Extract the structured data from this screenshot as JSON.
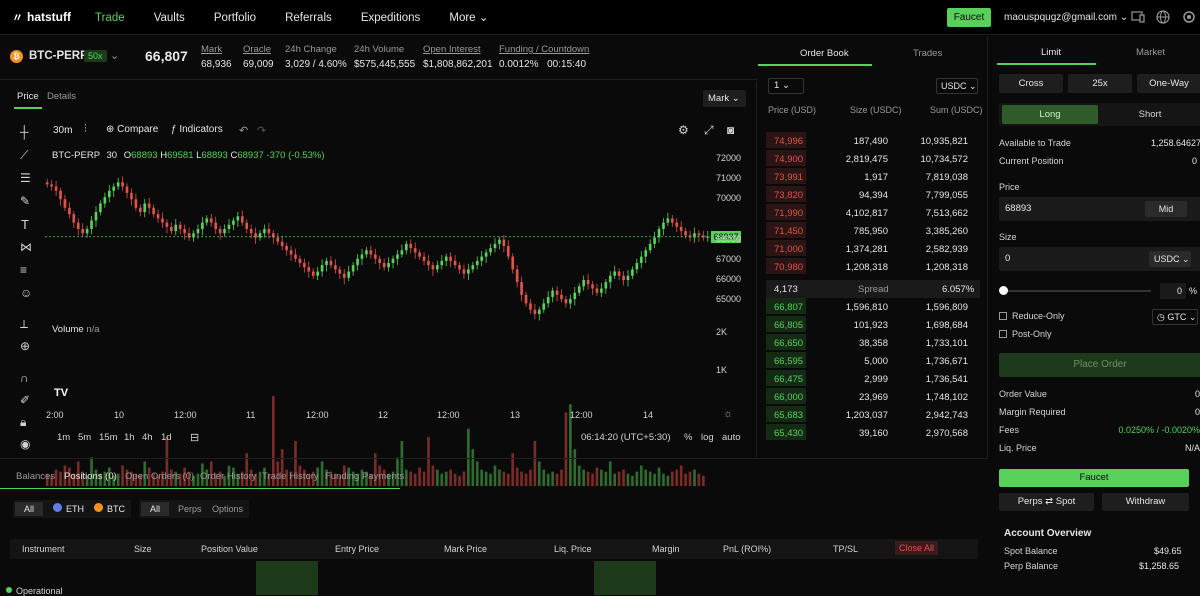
{
  "nav": {
    "brand": "hatstuff",
    "items": [
      "Trade",
      "Vaults",
      "Portfolio",
      "Referrals",
      "Expeditions",
      "More"
    ],
    "faucet": "Faucet",
    "email": "maouspqugz@gmail.com"
  },
  "market": {
    "symbol": "BTC-PERP",
    "leverage": "50x",
    "price": "66,807",
    "stats": [
      {
        "label": "Mark",
        "value": "68,936"
      },
      {
        "label": "Oracle",
        "value": "69,009"
      },
      {
        "label": "24h Change",
        "value": "3,029 / 4.60%"
      },
      {
        "label": "24h Volume",
        "value": "$575,445,555"
      },
      {
        "label": "Open Interest",
        "value": "$1,808,862,201"
      },
      {
        "label": "Funding / Countdown",
        "value": "0.0012%",
        "value2": "00:15:40"
      }
    ]
  },
  "chart": {
    "tabs": [
      "Price",
      "Details"
    ],
    "mark_select": "Mark",
    "interval": "30m",
    "compare": "Compare",
    "indicators": "Indicators",
    "legend_symbol": "BTC-PERP",
    "legend_interval": "30",
    "legend_o": "68893",
    "legend_h": "69581",
    "legend_l": "68893",
    "legend_c": "68937",
    "legend_chg": "-370 (-0.53%)",
    "current_price_label": "68937",
    "volume_label": "Volume",
    "volume_na": "n/a",
    "y_ticks": [
      "72000",
      "71000",
      "70000",
      "69000",
      "68000",
      "67000",
      "66000",
      "65000"
    ],
    "vol_ticks": [
      "2K",
      "1K"
    ],
    "x_ticks": [
      "2:00",
      "10",
      "12:00",
      "11",
      "12:00",
      "12",
      "12:00",
      "13",
      "12:00",
      "14"
    ],
    "timeframes": [
      "1m",
      "5m",
      "15m",
      "1h",
      "4h",
      "1d"
    ],
    "time": "06:14:20 (UTC+5:30)",
    "scale_opts": [
      "%",
      "log",
      "auto"
    ]
  },
  "chart_data": {
    "type": "candlestick",
    "symbol": "BTC-PERP",
    "interval": "30m",
    "ylim": [
      64500,
      72500
    ],
    "closes": [
      71400,
      71300,
      71100,
      70700,
      70300,
      70000,
      69600,
      69300,
      69100,
      69300,
      69700,
      70100,
      70500,
      70800,
      71100,
      71300,
      71500,
      71300,
      71000,
      70700,
      70300,
      70100,
      70500,
      70300,
      70000,
      69800,
      69600,
      69400,
      69200,
      69500,
      69300,
      69100,
      68900,
      69100,
      69300,
      69600,
      69800,
      69600,
      69300,
      69100,
      69300,
      69500,
      69700,
      69900,
      69600,
      69300,
      69100,
      68900,
      69100,
      69300,
      69100,
      68900,
      68700,
      68500,
      68300,
      68100,
      67900,
      67700,
      67500,
      67300,
      67100,
      67300,
      67600,
      67800,
      67600,
      67400,
      67200,
      67000,
      67300,
      67600,
      67900,
      68100,
      68300,
      68100,
      67900,
      67700,
      67500,
      67700,
      67900,
      68100,
      68300,
      68600,
      68400,
      68200,
      68000,
      67800,
      67600,
      67400,
      67600,
      67800,
      68000,
      67800,
      67600,
      67400,
      67200,
      67400,
      67600,
      67800,
      68000,
      68200,
      68400,
      68600,
      68800,
      68500,
      68000,
      67400,
      66800,
      66200,
      65800,
      65500,
      65300,
      65500,
      65800,
      66100,
      66400,
      66200,
      66000,
      65800,
      66000,
      66300,
      66600,
      66900,
      66700,
      66500,
      66300,
      66500,
      66800,
      67100,
      67300,
      67100,
      66900,
      67100,
      67400,
      67700,
      68000,
      68300,
      68600,
      68900,
      69300,
      69600,
      69800,
      69600,
      69400,
      69200,
      69000,
      68900,
      69100,
      69000,
      68900,
      68937
    ],
    "volumes": [
      300,
      250,
      400,
      350,
      500,
      450,
      300,
      600,
      350,
      250,
      700,
      400,
      300,
      350,
      450,
      250,
      300,
      500,
      400,
      350,
      300,
      280,
      600,
      450,
      300,
      250,
      350,
      1200,
      400,
      350,
      300,
      450,
      350,
      250,
      300,
      550,
      400,
      600,
      300,
      350,
      250,
      500,
      450,
      300,
      350,
      800,
      400,
      300,
      350,
      450,
      300,
      2200,
      600,
      900,
      400,
      350,
      1100,
      500,
      400,
      300,
      350,
      450,
      600,
      400,
      350,
      300,
      250,
      500,
      450,
      350,
      300,
      400,
      350,
      300,
      800,
      500,
      400,
      300,
      350,
      700,
      1100,
      400,
      350,
      300,
      450,
      350,
      1200,
      500,
      400,
      300,
      350,
      400,
      300,
      250,
      350,
      1400,
      900,
      600,
      400,
      350,
      300,
      500,
      400,
      350,
      300,
      800,
      450,
      350,
      300,
      400,
      1100,
      600,
      400,
      300,
      350,
      300,
      400,
      1800,
      2000,
      900,
      500,
      400,
      350,
      300,
      450,
      400,
      350,
      600,
      300,
      350,
      400,
      300,
      250,
      350,
      500,
      400,
      350,
      300,
      450,
      300,
      250,
      350,
      400,
      500,
      300,
      350,
      400,
      300,
      250
    ],
    "price_ticks": [
      72000,
      71000,
      70000,
      69000,
      68000,
      67000,
      66000,
      65000
    ],
    "last_price": 68937
  },
  "orderbook": {
    "tabs": [
      "Order Book",
      "Trades"
    ],
    "step": "1",
    "currency": "USDC",
    "headers": [
      "Price (USD)",
      "Size (USDC)",
      "Sum (USDC)"
    ],
    "asks": [
      [
        "74,996",
        "187,490",
        "10,935,821"
      ],
      [
        "74,900",
        "2,819,475",
        "10,734,572"
      ],
      [
        "73,991",
        "1,917",
        "7,819,038"
      ],
      [
        "73,820",
        "94,394",
        "7,799,055"
      ],
      [
        "71,990",
        "4,102,817",
        "7,513,662"
      ],
      [
        "71,450",
        "785,950",
        "3,385,260"
      ],
      [
        "71,000",
        "1,374,281",
        "2,582,939"
      ],
      [
        "70,980",
        "1,208,318",
        "1,208,318"
      ]
    ],
    "spread": [
      "4,173",
      "Spread",
      "6.057%"
    ],
    "bids": [
      [
        "66,807",
        "1,596,810",
        "1,596,809"
      ],
      [
        "66,805",
        "101,923",
        "1,698,684"
      ],
      [
        "66,650",
        "38,358",
        "1,733,101"
      ],
      [
        "66,595",
        "5,000",
        "1,736,671"
      ],
      [
        "66,475",
        "2,999",
        "1,736,541"
      ],
      [
        "66,000",
        "23,969",
        "1,748,102"
      ],
      [
        "65,683",
        "1,203,037",
        "2,942,743"
      ],
      [
        "65,430",
        "39,160",
        "2,970,568"
      ]
    ]
  },
  "trade": {
    "tabs": [
      "Limit",
      "Market"
    ],
    "margin_modes": [
      "Cross",
      "25x",
      "One-Way"
    ],
    "sides": [
      "Long",
      "Short"
    ],
    "available_label": "Available to Trade",
    "available_value": "1,258.64627",
    "position_label": "Current Position",
    "position_value": "0",
    "price_label": "Price",
    "price_value": "68893",
    "mid": "Mid",
    "size_label": "Size",
    "size_value": "0",
    "size_currency": "USDC",
    "slider_value": "0",
    "slider_unit": "%",
    "reduce_only": "Reduce-Only",
    "post_only": "Post-Only",
    "tif": "GTC",
    "place_order": "Place Order",
    "summary": [
      {
        "label": "Order Value",
        "value": "0"
      },
      {
        "label": "Margin Required",
        "value": "0"
      },
      {
        "label": "Fees",
        "value": "0.0250% / -0.0020%"
      },
      {
        "label": "Liq. Price",
        "value": "N/A"
      }
    ],
    "faucet": "Faucet",
    "perps_spot": "Perps ⇄ Spot",
    "withdraw": "Withdraw",
    "account_title": "Account Overview",
    "account": [
      {
        "label": "Spot Balance",
        "value": "$49.65"
      },
      {
        "label": "Perp Balance",
        "value": "$1,258.65"
      }
    ]
  },
  "bottom": {
    "tabs": [
      "Balances",
      "Positions (0)",
      "Open Orders (0)",
      "Order History",
      "Trade History",
      "Funding Payments"
    ],
    "asset_filters": [
      "All",
      "ETH",
      "BTC"
    ],
    "type_filters": [
      "All",
      "Perps",
      "Options"
    ],
    "columns": [
      "Instrument",
      "Size",
      "Position Value",
      "Entry Price",
      "Mark Price",
      "Liq. Price",
      "Margin",
      "PnL (ROI%)",
      "TP/SL"
    ],
    "close_all": "Close All",
    "status": "Operational"
  },
  "colors": {
    "accent": "#58d15a",
    "down": "#e0524a",
    "bg": "#0a0a0a",
    "panel": "#1e1e1e"
  }
}
